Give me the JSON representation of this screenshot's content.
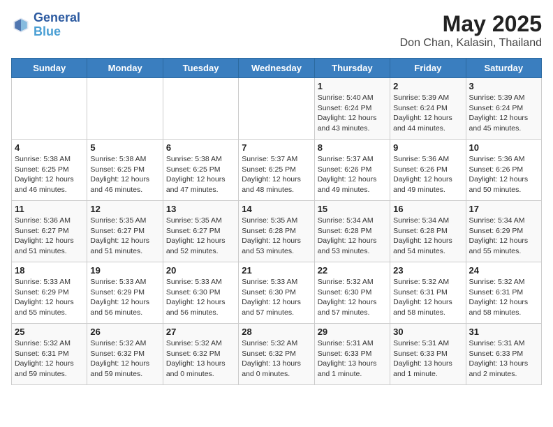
{
  "logo": {
    "line1": "General",
    "line2": "Blue"
  },
  "title": "May 2025",
  "subtitle": "Don Chan, Kalasin, Thailand",
  "weekdays": [
    "Sunday",
    "Monday",
    "Tuesday",
    "Wednesday",
    "Thursday",
    "Friday",
    "Saturday"
  ],
  "weeks": [
    [
      {
        "day": "",
        "info": ""
      },
      {
        "day": "",
        "info": ""
      },
      {
        "day": "",
        "info": ""
      },
      {
        "day": "",
        "info": ""
      },
      {
        "day": "1",
        "info": "Sunrise: 5:40 AM\nSunset: 6:24 PM\nDaylight: 12 hours\nand 43 minutes."
      },
      {
        "day": "2",
        "info": "Sunrise: 5:39 AM\nSunset: 6:24 PM\nDaylight: 12 hours\nand 44 minutes."
      },
      {
        "day": "3",
        "info": "Sunrise: 5:39 AM\nSunset: 6:24 PM\nDaylight: 12 hours\nand 45 minutes."
      }
    ],
    [
      {
        "day": "4",
        "info": "Sunrise: 5:38 AM\nSunset: 6:25 PM\nDaylight: 12 hours\nand 46 minutes."
      },
      {
        "day": "5",
        "info": "Sunrise: 5:38 AM\nSunset: 6:25 PM\nDaylight: 12 hours\nand 46 minutes."
      },
      {
        "day": "6",
        "info": "Sunrise: 5:38 AM\nSunset: 6:25 PM\nDaylight: 12 hours\nand 47 minutes."
      },
      {
        "day": "7",
        "info": "Sunrise: 5:37 AM\nSunset: 6:25 PM\nDaylight: 12 hours\nand 48 minutes."
      },
      {
        "day": "8",
        "info": "Sunrise: 5:37 AM\nSunset: 6:26 PM\nDaylight: 12 hours\nand 49 minutes."
      },
      {
        "day": "9",
        "info": "Sunrise: 5:36 AM\nSunset: 6:26 PM\nDaylight: 12 hours\nand 49 minutes."
      },
      {
        "day": "10",
        "info": "Sunrise: 5:36 AM\nSunset: 6:26 PM\nDaylight: 12 hours\nand 50 minutes."
      }
    ],
    [
      {
        "day": "11",
        "info": "Sunrise: 5:36 AM\nSunset: 6:27 PM\nDaylight: 12 hours\nand 51 minutes."
      },
      {
        "day": "12",
        "info": "Sunrise: 5:35 AM\nSunset: 6:27 PM\nDaylight: 12 hours\nand 51 minutes."
      },
      {
        "day": "13",
        "info": "Sunrise: 5:35 AM\nSunset: 6:27 PM\nDaylight: 12 hours\nand 52 minutes."
      },
      {
        "day": "14",
        "info": "Sunrise: 5:35 AM\nSunset: 6:28 PM\nDaylight: 12 hours\nand 53 minutes."
      },
      {
        "day": "15",
        "info": "Sunrise: 5:34 AM\nSunset: 6:28 PM\nDaylight: 12 hours\nand 53 minutes."
      },
      {
        "day": "16",
        "info": "Sunrise: 5:34 AM\nSunset: 6:28 PM\nDaylight: 12 hours\nand 54 minutes."
      },
      {
        "day": "17",
        "info": "Sunrise: 5:34 AM\nSunset: 6:29 PM\nDaylight: 12 hours\nand 55 minutes."
      }
    ],
    [
      {
        "day": "18",
        "info": "Sunrise: 5:33 AM\nSunset: 6:29 PM\nDaylight: 12 hours\nand 55 minutes."
      },
      {
        "day": "19",
        "info": "Sunrise: 5:33 AM\nSunset: 6:29 PM\nDaylight: 12 hours\nand 56 minutes."
      },
      {
        "day": "20",
        "info": "Sunrise: 5:33 AM\nSunset: 6:30 PM\nDaylight: 12 hours\nand 56 minutes."
      },
      {
        "day": "21",
        "info": "Sunrise: 5:33 AM\nSunset: 6:30 PM\nDaylight: 12 hours\nand 57 minutes."
      },
      {
        "day": "22",
        "info": "Sunrise: 5:32 AM\nSunset: 6:30 PM\nDaylight: 12 hours\nand 57 minutes."
      },
      {
        "day": "23",
        "info": "Sunrise: 5:32 AM\nSunset: 6:31 PM\nDaylight: 12 hours\nand 58 minutes."
      },
      {
        "day": "24",
        "info": "Sunrise: 5:32 AM\nSunset: 6:31 PM\nDaylight: 12 hours\nand 58 minutes."
      }
    ],
    [
      {
        "day": "25",
        "info": "Sunrise: 5:32 AM\nSunset: 6:31 PM\nDaylight: 12 hours\nand 59 minutes."
      },
      {
        "day": "26",
        "info": "Sunrise: 5:32 AM\nSunset: 6:32 PM\nDaylight: 12 hours\nand 59 minutes."
      },
      {
        "day": "27",
        "info": "Sunrise: 5:32 AM\nSunset: 6:32 PM\nDaylight: 13 hours\nand 0 minutes."
      },
      {
        "day": "28",
        "info": "Sunrise: 5:32 AM\nSunset: 6:32 PM\nDaylight: 13 hours\nand 0 minutes."
      },
      {
        "day": "29",
        "info": "Sunrise: 5:31 AM\nSunset: 6:33 PM\nDaylight: 13 hours\nand 1 minute."
      },
      {
        "day": "30",
        "info": "Sunrise: 5:31 AM\nSunset: 6:33 PM\nDaylight: 13 hours\nand 1 minute."
      },
      {
        "day": "31",
        "info": "Sunrise: 5:31 AM\nSunset: 6:33 PM\nDaylight: 13 hours\nand 2 minutes."
      }
    ]
  ]
}
